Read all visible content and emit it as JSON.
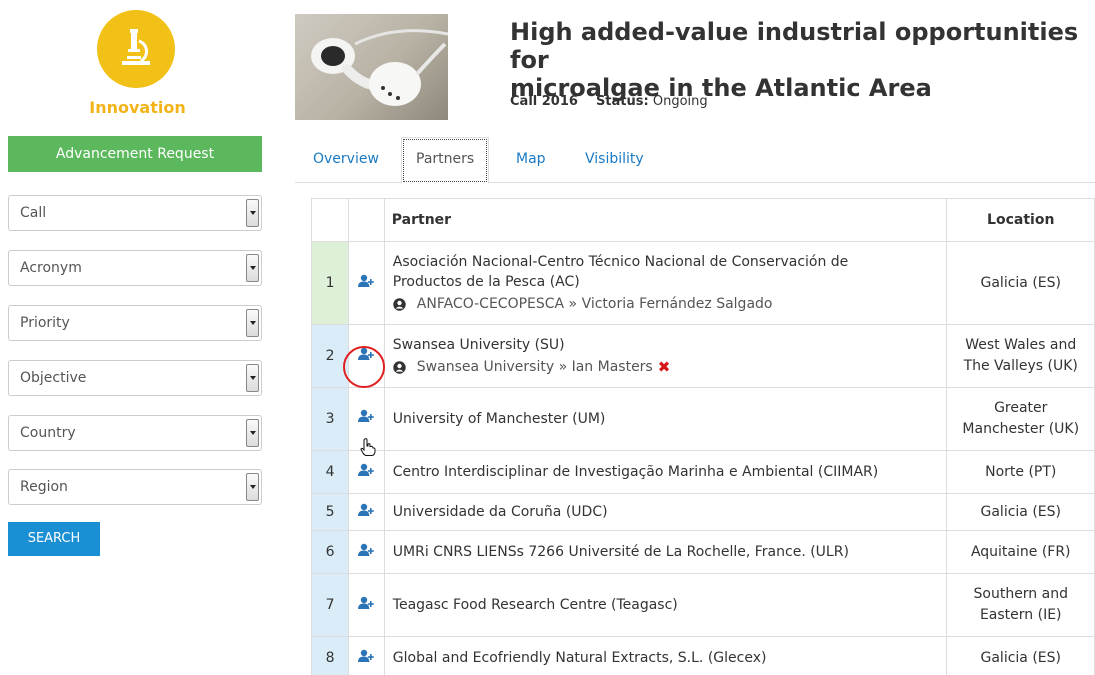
{
  "sidebar": {
    "badge_label": "Innovation",
    "advancement_button": "Advancement Request",
    "filters": [
      "Call",
      "Acronym",
      "Priority",
      "Objective",
      "Country",
      "Region"
    ],
    "search_button": "SEARCH"
  },
  "project": {
    "title_line1": "High added-value industrial opportunities for",
    "title_line2": "microalgae in the Atlantic Area",
    "call_label": "Call 2016",
    "status_label": "Status:",
    "status_value": "Ongoing"
  },
  "tabs": [
    "Overview",
    "Partners",
    "Map",
    "Visibility"
  ],
  "table": {
    "headers": {
      "partner": "Partner",
      "location": "Location"
    },
    "rows": [
      {
        "num": "1",
        "partner_line1": "Asociación Nacional-Centro Técnico Nacional de Conservación de",
        "partner_line2": "Productos de la Pesca (AC)",
        "contact": "ANFACO-CECOPESCA » Victoria Fernández Salgado",
        "loc1": "Galicia (ES)",
        "loc2": ""
      },
      {
        "num": "2",
        "partner_line1": "Swansea University (SU)",
        "partner_line2": "",
        "contact": "Swansea University » Ian Masters",
        "loc1": "West Wales and",
        "loc2": "The Valleys (UK)",
        "x_mark": "✖"
      },
      {
        "num": "3",
        "partner_line1": "University of Manchester (UM)",
        "partner_line2": "",
        "contact": "",
        "loc1": "Greater",
        "loc2": "Manchester (UK)"
      },
      {
        "num": "4",
        "partner_line1": "Centro Interdisciplinar de Investigação Marinha e Ambiental (CIIMAR)",
        "partner_line2": "",
        "contact": "",
        "loc1": "Norte (PT)",
        "loc2": ""
      },
      {
        "num": "5",
        "partner_line1": "Universidade da Coruña (UDC)",
        "partner_line2": "",
        "contact": "",
        "loc1": "Galicia (ES)",
        "loc2": ""
      },
      {
        "num": "6",
        "partner_line1": "UMRi CNRS LIENSs 7266 Université de La Rochelle, France. (ULR)",
        "partner_line2": "",
        "contact": "",
        "loc1": "Aquitaine (FR)",
        "loc2": ""
      },
      {
        "num": "7",
        "partner_line1": "Teagasc Food Research Centre (Teagasc)",
        "partner_line2": "",
        "contact": "",
        "loc1": "Southern and",
        "loc2": "Eastern (IE)"
      },
      {
        "num": "8",
        "partner_line1": "Global and Ecofriendly Natural Extracts, S.L. (Glecex)",
        "partner_line2": "",
        "contact": "",
        "loc1": "Galicia (ES)",
        "loc2": ""
      }
    ]
  },
  "colors": {
    "innovation_yellow": "#f2c118",
    "green_button": "#5cb85c",
    "blue_button": "#1a8fd3",
    "link_blue": "#1a7ac4",
    "row_blue": "#d9ecf7",
    "row_green": "#dff0d8",
    "annotation_red": "#e02020"
  },
  "icons": {
    "badge": "microscope-icon",
    "row_action": "add-user-icon",
    "contact": "user-circle-icon",
    "cursor": "hand-pointer-icon"
  }
}
